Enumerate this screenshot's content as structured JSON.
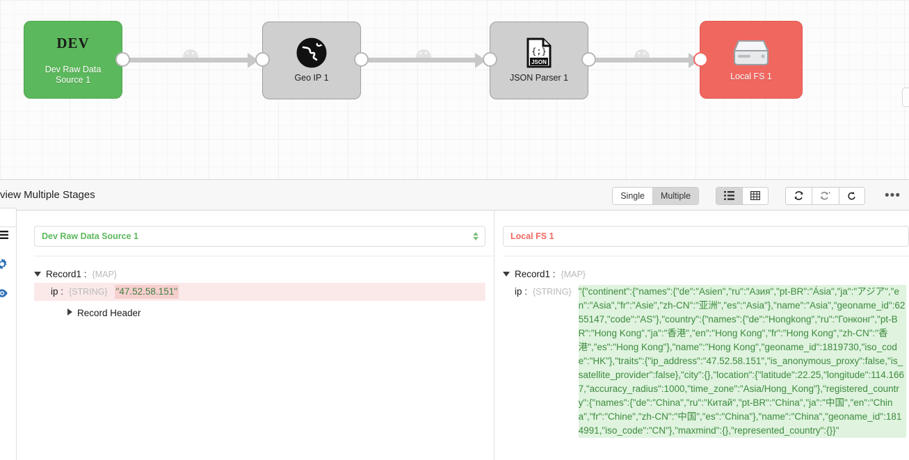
{
  "canvas": {
    "nodes": [
      {
        "id": "dev-raw-data-source-1",
        "badge": "DEV",
        "label": "Dev Raw Data\nSource 1",
        "label_line1": "Dev Raw Data",
        "label_line2": "Source 1",
        "icon": "dev-badge",
        "color": "#5cb85c",
        "kind": "origin"
      },
      {
        "id": "geo-ip-1",
        "label": "Geo IP 1",
        "icon": "globe-icon",
        "color": "#cfcfcf",
        "kind": "processor"
      },
      {
        "id": "json-parser-1",
        "label": "JSON Parser 1",
        "icon": "json-file-icon",
        "color": "#cfcfcf",
        "kind": "processor"
      },
      {
        "id": "local-fs-1",
        "label": "Local FS 1",
        "icon": "hard-drive-icon",
        "color": "#f0675f",
        "kind": "destination"
      }
    ]
  },
  "preview": {
    "title": "view Multiple Stages",
    "mode_toggle": {
      "options": [
        "Single",
        "Multiple"
      ],
      "selected": "Multiple"
    },
    "view_toggle": {
      "options": [
        "list-view-icon",
        "table-view-icon"
      ],
      "selected": "list-view-icon"
    },
    "actions": [
      "refresh-icon",
      "refresh-dot-icon",
      "undo-icon"
    ],
    "overflow_label": "•••"
  },
  "rail": {
    "icons": [
      "hamburger-icon",
      "gear-icon",
      "eye-icon"
    ]
  },
  "panels": {
    "left": {
      "stage": "Dev Raw Data Source 1",
      "record_label": "Record1 :",
      "record_type": "{MAP}",
      "field_key": "ip :",
      "field_type": "{STRING}",
      "field_value": "\"47.52.58.151\"",
      "record_header_label": "Record Header"
    },
    "right": {
      "stage": "Local FS 1",
      "record_label": "Record1 :",
      "record_type": "{MAP}",
      "field_key": "ip :",
      "field_type": "{STRING}",
      "field_value": "\"{\"continent\":{\"names\":{\"de\":\"Asien\",\"ru\":\"Азия\",\"pt-BR\":\"Ásia\",\"ja\":\"アジア\",\"en\":\"Asia\",\"fr\":\"Asie\",\"zh-CN\":\"亚洲\",\"es\":\"Asia\"},\"name\":\"Asia\",\"geoname_id\":6255147,\"code\":\"AS\"},\"country\":{\"names\":{\"de\":\"Hongkong\",\"ru\":\"Гонконг\",\"pt-BR\":\"Hong Kong\",\"ja\":\"香港\",\"en\":\"Hong Kong\",\"fr\":\"Hong Kong\",\"zh-CN\":\"香港\",\"es\":\"Hong Kong\"},\"name\":\"Hong Kong\",\"geoname_id\":1819730,\"iso_code\":\"HK\"},\"traits\":{\"ip_address\":\"47.52.58.151\",\"is_anonymous_proxy\":false,\"is_satellite_provider\":false},\"city\":{},\"location\":{\"latitude\":22.25,\"longitude\":114.1667,\"accuracy_radius\":1000,\"time_zone\":\"Asia/Hong_Kong\"},\"registered_country\":{\"names\":{\"de\":\"China\",\"ru\":\"Китай\",\"pt-BR\":\"China\",\"ja\":\"中国\",\"en\":\"China\",\"fr\":\"Chine\",\"zh-CN\":\"中国\",\"es\":\"China\"},\"name\":\"China\",\"geoname_id\":1814991,\"iso_code\":\"CN\"},\"maxmind\":{},\"represented_country\":{}}\""
    }
  },
  "colors": {
    "origin_green": "#5cb85c",
    "destination_red": "#f0675f",
    "processor_gray": "#cfcfcf",
    "highlight_green_bg": "#dff3df",
    "highlight_red_bg": "#fbe9ea"
  }
}
